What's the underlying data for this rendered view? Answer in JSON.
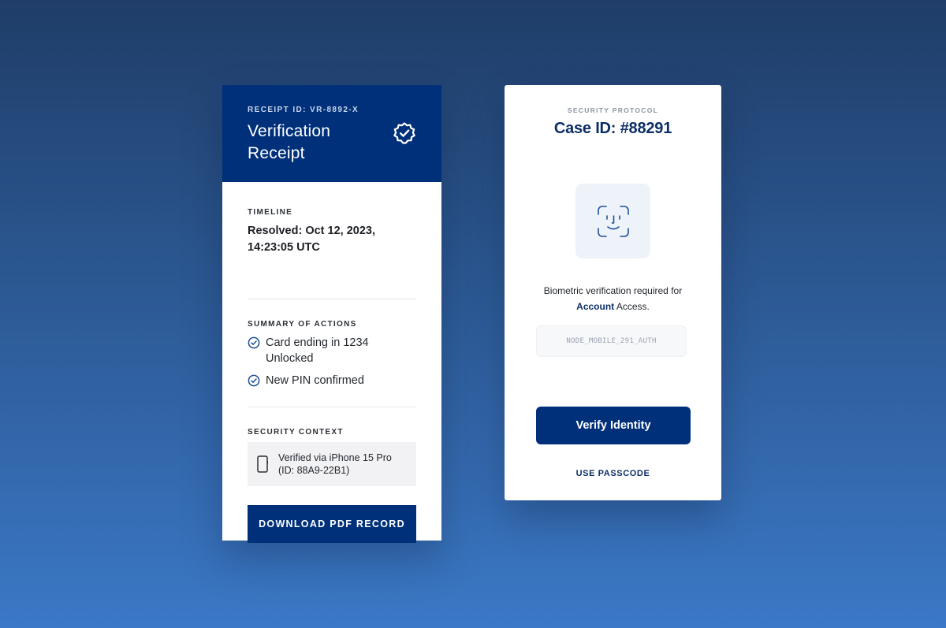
{
  "receipt": {
    "receipt_id": "RECEIPT ID: VR-8892-X",
    "title": "Verification Receipt",
    "badge_icon": "verified-badge-icon",
    "timeline": {
      "label": "TIMELINE",
      "value": "Resolved: Oct 12, 2023, 14:23:05 UTC"
    },
    "actions": {
      "label": "SUMMARY OF ACTIONS",
      "items": [
        {
          "icon": "check-circle-icon",
          "text": "Card ending in 1234 Unlocked"
        },
        {
          "icon": "check-circle-icon",
          "text": "New PIN confirmed"
        }
      ]
    },
    "security": {
      "label": "SECURITY CONTEXT",
      "device_icon": "phone-icon",
      "device_line1": "Verified via iPhone 15 Pro",
      "device_line2": "(ID: 88A9-22B1)"
    },
    "download_label": "DOWNLOAD PDF RECORD"
  },
  "protocol": {
    "kicker": "SECURITY PROTOCOL",
    "case_id": "Case ID: #88291",
    "face_icon": "face-id-icon",
    "bio_prefix": "Biometric verification required for",
    "bio_highlight": "Account",
    "bio_suffix": "Access.",
    "node_value": "NODE_MOBILE_291_AUTH",
    "verify_label": "Verify Identity",
    "passcode_label": "USE PASSCODE"
  },
  "colors": {
    "brand_navy": "#00307a",
    "heading_navy": "#0d2f66",
    "background_top": "#1f3d68",
    "background_bottom": "#3b78c6"
  }
}
